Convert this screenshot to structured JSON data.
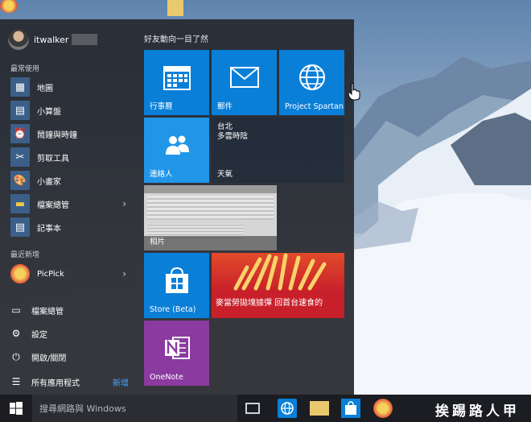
{
  "start_menu": {
    "user": {
      "name": "itwalker"
    },
    "most_used_label": "最常使用",
    "most_used": [
      {
        "label": "地圖",
        "icon": "map-icon"
      },
      {
        "label": "小算盤",
        "icon": "calculator-icon"
      },
      {
        "label": "鬧鐘與時鐘",
        "icon": "alarm-clock-icon"
      },
      {
        "label": "剪取工具",
        "icon": "snipping-tool-icon"
      },
      {
        "label": "小畫家",
        "icon": "paint-icon"
      },
      {
        "label": "檔案總管",
        "icon": "folder-icon"
      },
      {
        "label": "記事本",
        "icon": "notepad-icon"
      }
    ],
    "recent_label": "最近新增",
    "recent": [
      {
        "label": "PicPick",
        "icon": "picpick-icon"
      }
    ],
    "bottom": [
      {
        "label": "檔案總管",
        "icon": "folder-outline-icon"
      },
      {
        "label": "設定",
        "icon": "gear-icon"
      },
      {
        "label": "開啟/關閉",
        "icon": "power-icon"
      },
      {
        "label": "所有應用程式",
        "icon": "all-apps-icon",
        "badge": "新增"
      }
    ],
    "group_title": "好友動向一目了然",
    "tiles": [
      {
        "label": "行事曆",
        "icon": "calendar-icon",
        "color": "#0a7fd8"
      },
      {
        "label": "郵件",
        "icon": "mail-icon",
        "color": "#0a7fd8"
      },
      {
        "label": "Project Spartan",
        "icon": "globe-icon",
        "color": "#0a7fd8"
      },
      {
        "label": "連絡人",
        "icon": "people-icon",
        "color": "#2196e8"
      },
      {
        "label": "天氣",
        "icon": "weather-icon",
        "lines": [
          "台北",
          "多雲時陰"
        ]
      },
      {
        "label": "相片",
        "icon": "photo-icon"
      },
      {
        "label": "Store (Beta)",
        "icon": "store-icon",
        "color": "#0a7fd8"
      },
      {
        "label": "麥當勞拋塊據彈 回首台速食的",
        "icon": "news-icon",
        "color": "#c8202b"
      },
      {
        "label": "OneNote",
        "icon": "onenote-icon",
        "color": "#8b3aa0"
      }
    ]
  },
  "taskbar": {
    "search_placeholder": "搜尋網路與 Windows",
    "watermark": "挨踢路人甲"
  }
}
